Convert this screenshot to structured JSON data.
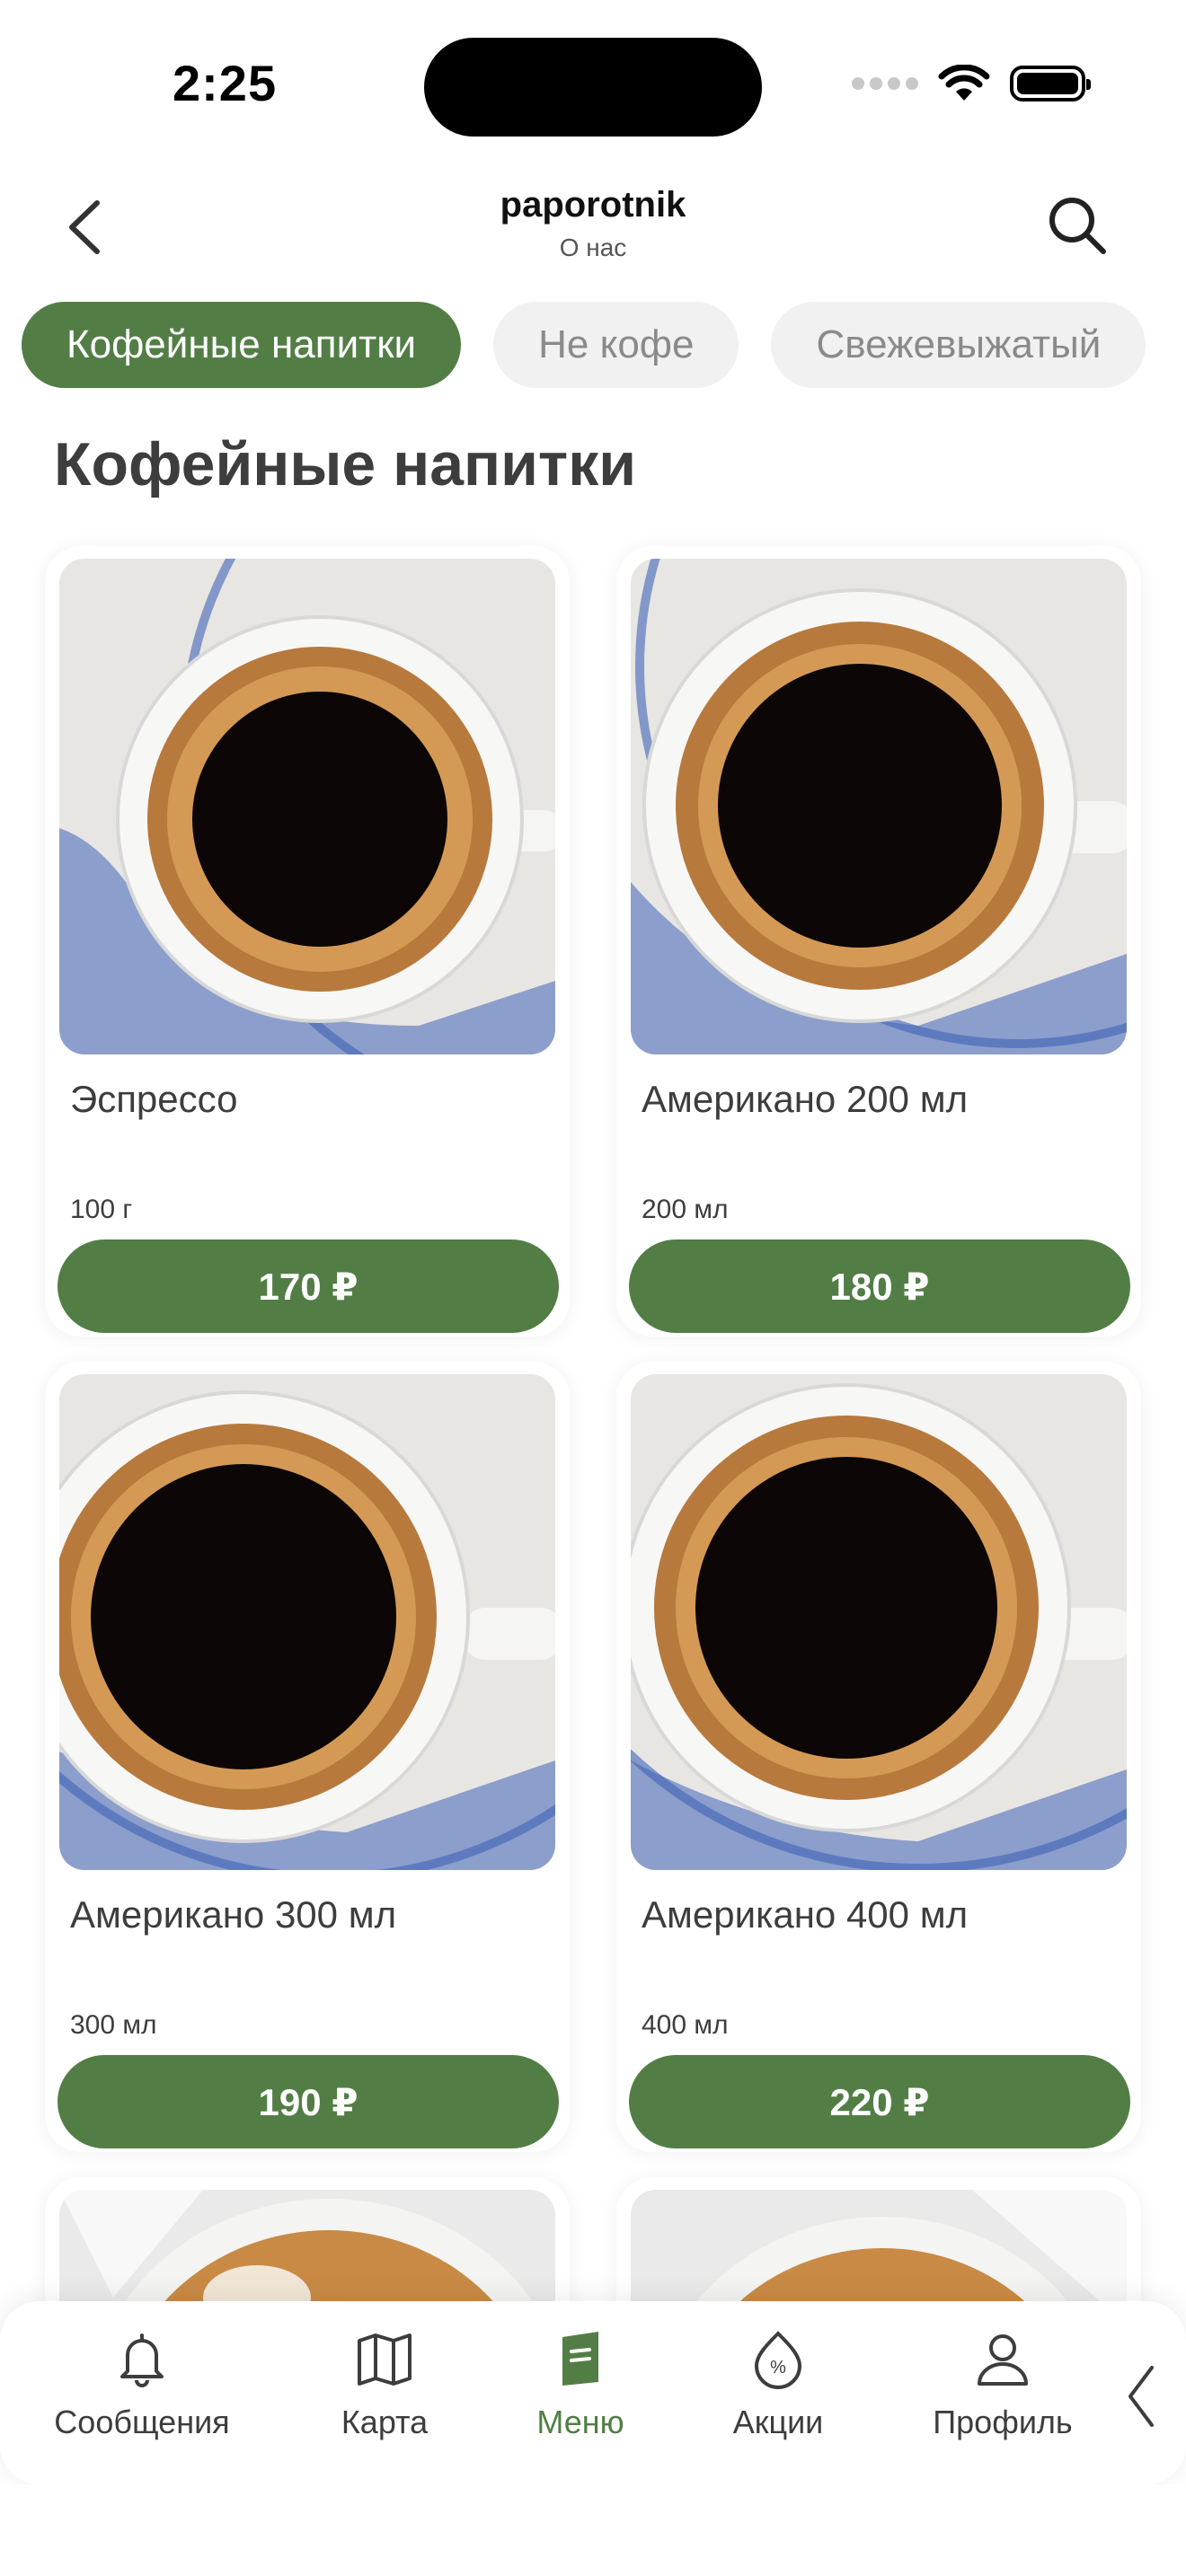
{
  "status_bar": {
    "time": "2:25"
  },
  "header": {
    "title": "paporotnik",
    "subtitle": "О нас"
  },
  "tabs": [
    {
      "label": "Кофейные напитки",
      "active": true
    },
    {
      "label": "Не кофе",
      "active": false
    },
    {
      "label": "Свежевыжатый",
      "active": false
    }
  ],
  "section_title": "Кофейные напитки",
  "products": [
    {
      "name": "Эспрессо",
      "weight": "100 г",
      "price": "170 ₽"
    },
    {
      "name": "Американо 200 мл",
      "weight": "200 мл",
      "price": "180 ₽"
    },
    {
      "name": "Американо 300 мл",
      "weight": "300 мл",
      "price": "190 ₽"
    },
    {
      "name": "Американо 400 мл",
      "weight": "400 мл",
      "price": "220 ₽"
    },
    {
      "name": "",
      "weight": "",
      "price": ""
    },
    {
      "name": "",
      "weight": "",
      "price": ""
    }
  ],
  "bottom_nav": [
    {
      "label": "Сообщения",
      "icon": "bell-icon",
      "active": false
    },
    {
      "label": "Карта",
      "icon": "map-icon",
      "active": false
    },
    {
      "label": "Меню",
      "icon": "menu-book-icon",
      "active": true
    },
    {
      "label": "Акции",
      "icon": "discount-icon",
      "active": false
    },
    {
      "label": "Профиль",
      "icon": "profile-icon",
      "active": false
    }
  ],
  "colors": {
    "accent": "#527e45",
    "tab_inactive_bg": "#f1f1f1",
    "text": "#3d3d3d"
  }
}
